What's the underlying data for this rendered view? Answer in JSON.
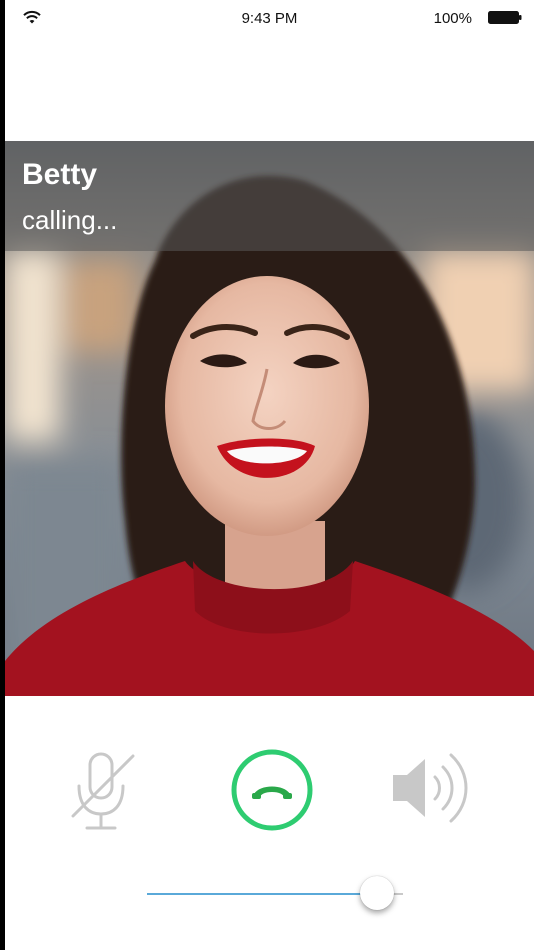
{
  "status_bar": {
    "time": "9:43 PM",
    "battery_percent": "100%",
    "icons": [
      "wifi-icon",
      "battery-icon"
    ]
  },
  "call": {
    "caller_name": "Betty",
    "status": "calling..."
  },
  "controls": {
    "mute_icon": "microphone-muted-icon",
    "hangup_icon": "phone-hangup-icon",
    "speaker_icon": "speaker-icon",
    "hangup_color": "#2ecc71",
    "inactive_color": "#c8c8c8"
  },
  "volume": {
    "level": 0.9,
    "track_color": "#5aa9d9"
  }
}
